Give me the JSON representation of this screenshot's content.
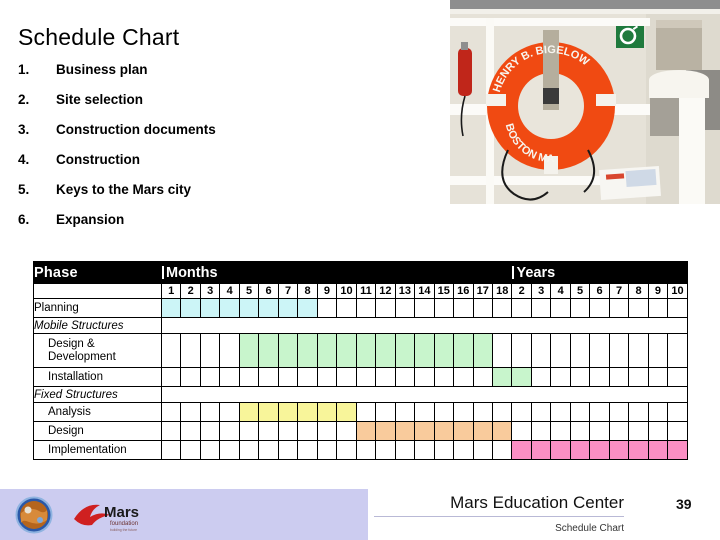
{
  "slide": {
    "title": "Schedule Chart",
    "agenda": [
      {
        "num": "1.",
        "label": "Business plan"
      },
      {
        "num": "2.",
        "label": "Site selection"
      },
      {
        "num": "3.",
        "label": "Construction documents"
      },
      {
        "num": "4.",
        "label": "Construction"
      },
      {
        "num": "5.",
        "label": "Keys to the Mars city"
      },
      {
        "num": "6.",
        "label": "Expansion"
      }
    ]
  },
  "photo": {
    "alt_name": "life-ring-on-ship-photo",
    "colors": {
      "wall": "#e4e0d6",
      "rail": "#fbfaf7",
      "ring": "#f04a12",
      "sign": "#1f7a3d",
      "extinguisher": "#c0261a"
    }
  },
  "chart_data": {
    "type": "table",
    "title": "Schedule Chart",
    "header_groups": [
      {
        "label": "Phase",
        "kind": "label"
      },
      {
        "label": "Months",
        "kind": "months"
      },
      {
        "label": "Years",
        "kind": "years"
      }
    ],
    "columns": {
      "months": [
        "1",
        "2",
        "3",
        "4",
        "5",
        "6",
        "7",
        "8",
        "9",
        "10",
        "11",
        "12",
        "13",
        "14",
        "15",
        "16",
        "17",
        "18"
      ],
      "years": [
        "2",
        "3",
        "4",
        "5",
        "6",
        "7",
        "8",
        "9",
        "10"
      ]
    },
    "colors": {
      "planning": "#ccf5f7",
      "mobile": "#c8f5cc",
      "analysis": "#f8f59a",
      "design": "#f9cb9c",
      "implementation": "#fb8fc4",
      "header_bg": "#000000",
      "header_fg": "#ffffff"
    },
    "rows": [
      {
        "label": "Planning",
        "kind": "task",
        "indent": false,
        "color_key": "planning",
        "months": [
          1,
          2,
          3,
          4,
          5,
          6,
          7,
          8
        ],
        "years": []
      },
      {
        "label": "Mobile Structures",
        "kind": "group",
        "indent": false,
        "color_key": null,
        "months": [],
        "years": []
      },
      {
        "label": "Design & Development",
        "kind": "task",
        "indent": true,
        "color_key": "mobile",
        "months": [
          5,
          6,
          7,
          8,
          9,
          10,
          11,
          12,
          13,
          14,
          15,
          16,
          17
        ],
        "years": []
      },
      {
        "label": "Installation",
        "kind": "task",
        "indent": true,
        "color_key": "mobile",
        "months": [
          18
        ],
        "years": [
          2
        ]
      },
      {
        "label": "Fixed Structures",
        "kind": "group",
        "indent": false,
        "color_key": null,
        "months": [],
        "years": []
      },
      {
        "label": "Analysis",
        "kind": "task",
        "indent": true,
        "color_key": "analysis",
        "months": [
          5,
          6,
          7,
          8,
          9,
          10
        ],
        "years": []
      },
      {
        "label": "Design",
        "kind": "task",
        "indent": true,
        "color_key": "design",
        "months": [
          11,
          12,
          13,
          14,
          15,
          16,
          17,
          18
        ],
        "years": []
      },
      {
        "label": "Implementation",
        "kind": "task",
        "indent": true,
        "color_key": "implementation",
        "months": [],
        "years": [
          2,
          3,
          4,
          5,
          6,
          7,
          8,
          9,
          10
        ]
      }
    ]
  },
  "footer": {
    "organization": "Mars Education Center",
    "subtitle": "Schedule Chart",
    "page_number": "39",
    "band_color": "#ccccf0",
    "logo_left_name": "mars-globe-logo",
    "logo_right_name": "mars-foundation-logo",
    "logo_right_text": "Mars",
    "logo_right_subtext": "foundation"
  }
}
